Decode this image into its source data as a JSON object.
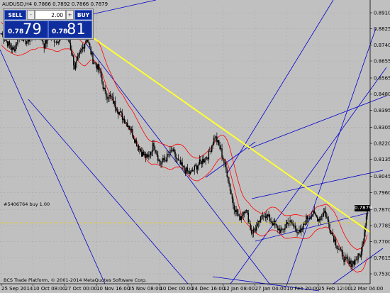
{
  "window": {
    "symbol": "AUDUSD,H4",
    "ohlc": "0.7866 0.7892 0.7866 0.7879"
  },
  "trade_panel": {
    "sell_label": "SELL",
    "buy_label": "BUY",
    "lot_value": "2.00",
    "minus_label": "-",
    "plus_label": "+",
    "sell_price_small": "0.78",
    "sell_price_big": "79",
    "buy_price_small": "0.78",
    "buy_price_big": "81"
  },
  "order_label": "#5406764 buy 1.00",
  "current_price": "0.7879",
  "copyright": "BCS Trade Platform, © 2001-2014 MetaQuotes Software Corp.",
  "colors": {
    "background": "#c0c0c0",
    "candles": "#000000",
    "bands": "#ff0000",
    "fan_lines": "#0000cc",
    "trendline": "#ffff33",
    "order_line": "#e6d200",
    "trade_button": "#0f2d9c"
  },
  "chart_data": {
    "type": "candlestick",
    "instrument": "AUDUSD",
    "timeframe": "H4",
    "ylim": [
      0.753,
      0.891
    ],
    "y_ticks": [
      "0.8910",
      "0.8825",
      "0.8740",
      "0.8655",
      "0.8565",
      "0.8480",
      "0.8395",
      "0.8305",
      "0.8220",
      "0.8135",
      "0.8045",
      "0.7960",
      "0.7870",
      "0.7785",
      "0.7700",
      "0.7615",
      "0.7530"
    ],
    "x_ticks": [
      "25 Sep 2014",
      "10 Oct 08:00",
      "27 Oct 00:00",
      "10 Nov 16:00",
      "25 Nov 08:00",
      "10 Dec 00:00",
      "24 Dec 16:00",
      "12 Jan 08:00",
      "27 Jan 04:00",
      "10 Feb 20:00",
      "25 Feb 12:00",
      "12 Mar 04:00"
    ],
    "close_path": [
      0.88,
      0.875,
      0.871,
      0.88,
      0.876,
      0.878,
      0.882,
      0.874,
      0.879,
      0.876,
      0.88,
      0.878,
      0.862,
      0.87,
      0.878,
      0.866,
      0.861,
      0.848,
      0.846,
      0.84,
      0.835,
      0.831,
      0.823,
      0.817,
      0.814,
      0.822,
      0.811,
      0.814,
      0.818,
      0.812,
      0.808,
      0.806,
      0.81,
      0.813,
      0.816,
      0.826,
      0.818,
      0.806,
      0.79,
      0.782,
      0.788,
      0.775,
      0.778,
      0.785,
      0.782,
      0.778,
      0.775,
      0.781,
      0.778,
      0.774,
      0.782,
      0.785,
      0.782,
      0.786,
      0.776,
      0.768,
      0.762,
      0.758,
      0.76,
      0.764,
      0.788
    ],
    "trendline": {
      "from": [
        "start",
        0.886
      ],
      "to": [
        "end",
        0.775
      ],
      "color": "#ffff33"
    },
    "order_level": 0.78
  }
}
